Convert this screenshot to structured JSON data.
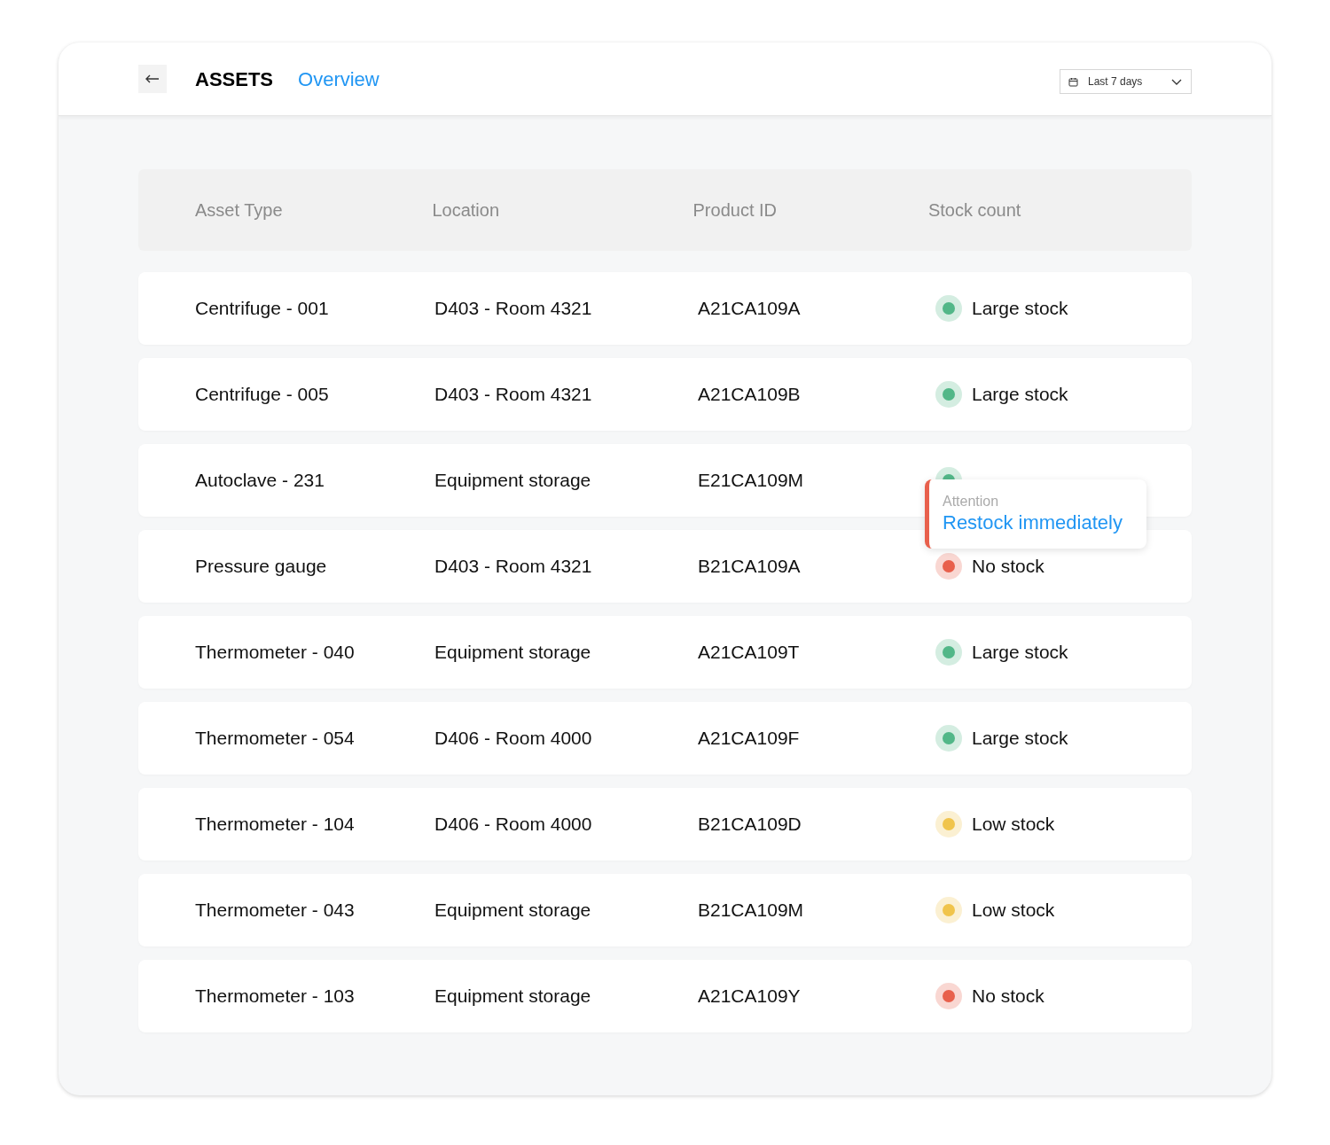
{
  "header": {
    "title": "ASSETS",
    "subtitle": "Overview",
    "date_range": "Last 7 days"
  },
  "table": {
    "columns": [
      "Asset Type",
      "Location",
      "Product ID",
      "Stock count"
    ],
    "rows": [
      {
        "asset_type": "Centrifuge - 001",
        "location": "D403 - Room 4321",
        "product_id": "A21CA109A",
        "stock": "Large stock",
        "color": "#52b788"
      },
      {
        "asset_type": "Centrifuge - 005",
        "location": "D403 - Room 4321",
        "product_id": "A21CA109B",
        "stock": "Large stock",
        "color": "#52b788"
      },
      {
        "asset_type": "Autoclave - 231",
        "location": "Equipment storage",
        "product_id": "E21CA109M",
        "color": "#52b788"
      },
      {
        "asset_type": "Pressure gauge",
        "location": "D403 - Room 4321",
        "product_id": "B21CA109A",
        "stock": "No stock",
        "color": "#e8604c"
      },
      {
        "asset_type": "Thermometer - 040",
        "location": "Equipment storage",
        "product_id": "A21CA109T",
        "stock": "Large stock",
        "color": "#52b788"
      },
      {
        "asset_type": "Thermometer - 054",
        "location": "D406 - Room 4000",
        "product_id": "A21CA109F",
        "stock": "Large stock",
        "color": "#52b788"
      },
      {
        "asset_type": "Thermometer - 104",
        "location": "D406 - Room 4000",
        "product_id": "B21CA109D",
        "stock": "Low stock",
        "color": "#f0c44c"
      },
      {
        "asset_type": "Thermometer - 043",
        "location": "Equipment storage",
        "product_id": "B21CA109M",
        "stock": "Low stock",
        "color": "#f0c44c"
      },
      {
        "asset_type": "Thermometer - 103",
        "location": "Equipment storage",
        "product_id": "A21CA109Y",
        "stock": "No stock",
        "color": "#e8604c"
      }
    ]
  },
  "tooltip": {
    "label": "Attention",
    "message": "Restock immediately"
  }
}
